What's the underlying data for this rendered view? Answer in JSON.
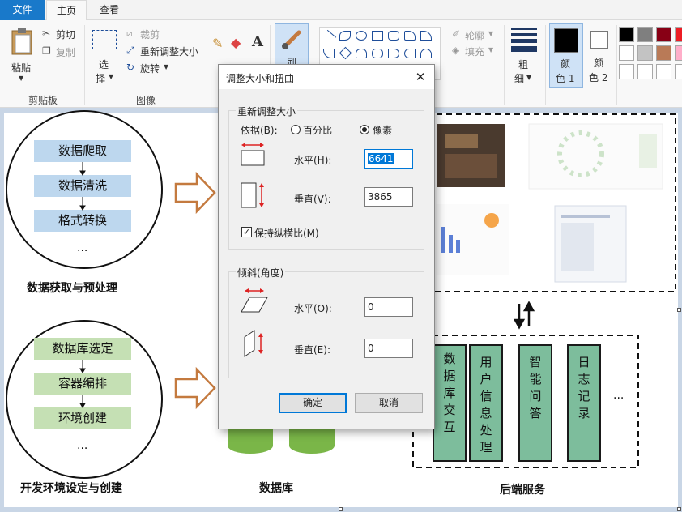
{
  "tabs": {
    "file": "文件",
    "home": "主页",
    "view": "查看"
  },
  "ribbon": {
    "paste": "粘贴",
    "cut": "剪切",
    "copy": "复制",
    "clipboard_group": "剪贴板",
    "select_line1": "选",
    "select_line2": "择",
    "crop": "裁剪",
    "resize": "重新调整大小",
    "rotate": "旋转",
    "image_group": "图像",
    "brush_partial": "刷",
    "outline": "轮廓",
    "fill": "填充",
    "size_line1": "粗",
    "size_line2": "细",
    "color1_line1": "颜",
    "color1_line2": "色 1",
    "color2_line1": "颜",
    "color2_line2": "色 2",
    "palette_row1": [
      "#000000",
      "#7f7f7f",
      "#880015",
      "#ed1c24"
    ],
    "palette_row2": [
      "#ffffff",
      "#c3c3c3",
      "#b97a57",
      "#ffaec9"
    ],
    "palette_row3": [
      "#ffffff",
      "#ffffff",
      "#ffffff",
      "#ffffff"
    ]
  },
  "diagram": {
    "acquisition": {
      "steps": [
        "数据爬取",
        "数据清洗",
        "格式转换"
      ],
      "more": "...",
      "caption": "数据获取与预处理"
    },
    "environment": {
      "steps": [
        "数据库选定",
        "容器编排",
        "环境创建"
      ],
      "more": "...",
      "caption": "开发环境设定与创建"
    },
    "database_caption": "数据库",
    "backend": {
      "modules": [
        [
          "数",
          "据",
          "库",
          "交",
          "互"
        ],
        [
          "用",
          "户",
          "信",
          "息",
          "处",
          "理"
        ],
        [
          "智",
          "能",
          "问",
          "答"
        ],
        [
          "日",
          "志",
          "记",
          "录"
        ]
      ],
      "more": "...",
      "caption": "后端服务"
    }
  },
  "dialog": {
    "title": "调整大小和扭曲",
    "close": "✕",
    "resize_section": "重新调整大小",
    "basis_label": "依据(B):",
    "option_percent": "百分比",
    "option_pixels": "像素",
    "horizontal_label": "水平(H):",
    "horizontal_value": "6641",
    "vertical_label": "垂直(V):",
    "vertical_value": "3865",
    "keep_ratio_label": "保持纵横比(M)",
    "keep_ratio_checked": true,
    "skew_section": "倾斜(角度)",
    "skew_h_label": "水平(O):",
    "skew_h_value": "0",
    "skew_v_label": "垂直(E):",
    "skew_v_value": "0",
    "ok": "确定",
    "cancel": "取消"
  },
  "colors": {
    "accent": "#1979ca",
    "focus": "#0078d7",
    "arrow": "#c47a3f",
    "module": "#7dbd9c"
  }
}
